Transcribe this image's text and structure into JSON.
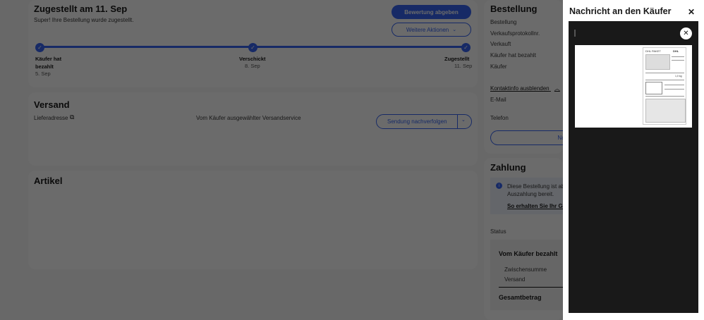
{
  "order_status": {
    "title": "Zugestellt am 11. Sep",
    "subtitle": "Super! Ihre Bestellung wurde zugestellt.",
    "feedback_button": "Bewertung abgeben",
    "more_actions_button": "Weitere Aktionen",
    "steps": [
      {
        "label_line1": "Käufer hat",
        "label_line2": "bezahlt",
        "date": "5. Sep"
      },
      {
        "label_line1": "Verschickt",
        "label_line2": "",
        "date": "8. Sep"
      },
      {
        "label_line1": "Zugestellt",
        "label_line2": "",
        "date": "11. Sep"
      }
    ]
  },
  "shipping": {
    "title": "Versand",
    "address_label": "Lieferadresse",
    "service_label": "Vom Käufer ausgewählter Versandservice",
    "track_button": "Sendung nachverfolgen"
  },
  "items": {
    "title": "Artikel"
  },
  "order": {
    "title": "Bestellung",
    "rows": [
      "Bestellung",
      "Verkaufsprotokollnr.",
      "Verkauft",
      "Käufer hat bezahlt",
      "Käufer"
    ],
    "contact_toggle": "Kontaktinfo ausblenden",
    "email_label": "E-Mail",
    "phone_label": "Telefon",
    "message_button_partial": "Na"
  },
  "payment": {
    "title": "Zahlung",
    "info_line1": "Diese Bestellung ist ab",
    "info_line2": "Auszahlung bereit.",
    "info_link": "So erhalten Sie Ihr Ge",
    "status_label": "Status",
    "paid_title": "Vom Käufer bezahlt",
    "subtotal_label": "Zwischensumme",
    "shipping_label": "Versand",
    "total_label": "Gesamtbetrag"
  },
  "message_panel": {
    "title": "Nachricht an den Käufer",
    "close_icon": "close-icon"
  },
  "attachment_preview": {
    "doc_header_left": "DHL PAKET",
    "doc_brand": "DHL",
    "doc_weight": "1,0 kg"
  }
}
